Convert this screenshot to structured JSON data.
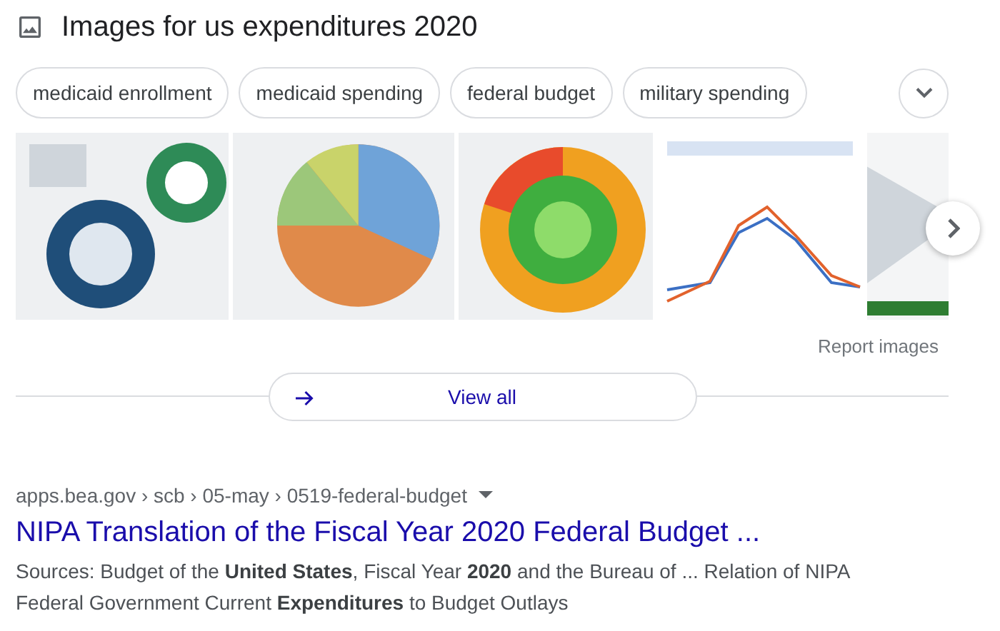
{
  "heading": {
    "title": "Images for us expenditures 2020"
  },
  "chips": [
    {
      "label": "medicaid enrollment"
    },
    {
      "label": "medicaid spending"
    },
    {
      "label": "federal budget"
    },
    {
      "label": "military spending"
    }
  ],
  "report_link": "Report images",
  "view_all": "View all",
  "result": {
    "breadcrumb": "apps.bea.gov › scb › 05-may › 0519-federal-budget",
    "title": "NIPA Translation of the Fiscal Year 2020 Federal Budget ...",
    "snippet": "Sources: Budget of the **United States**, Fiscal Year **2020** and the Bureau of ... Relation of NIPA Federal Government Current **Expenditures** to Budget Outlays"
  }
}
